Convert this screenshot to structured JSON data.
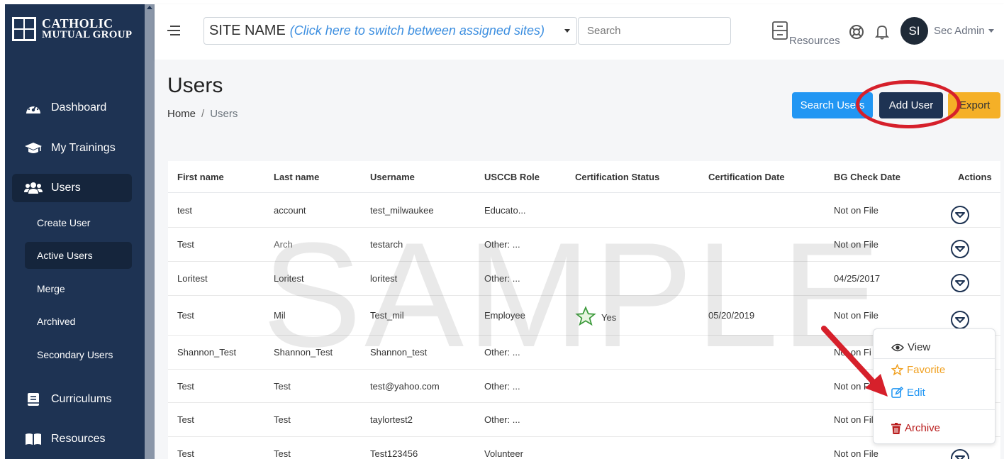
{
  "brand": {
    "line1": "CATHOLIC",
    "line2": "MUTUAL GROUP"
  },
  "sidebar": {
    "items": [
      {
        "label": "Dashboard",
        "icon": "dashboard-icon"
      },
      {
        "label": "My Trainings",
        "icon": "graduation-cap-icon"
      },
      {
        "label": "Users",
        "icon": "users-icon"
      },
      {
        "label": "Curriculums",
        "icon": "book-icon"
      },
      {
        "label": "Resources",
        "icon": "open-book-icon"
      }
    ],
    "users_sub": [
      "Create User",
      "Active Users",
      "Merge",
      "Archived",
      "Secondary Users"
    ]
  },
  "topbar": {
    "site_name": "SITE NAME",
    "site_hint": "(Click here to switch between assigned sites)",
    "search_placeholder": "Search",
    "resources_label": "Resources",
    "avatar_initials": "SI",
    "user_name": "Sec Admin"
  },
  "page": {
    "title": "Users",
    "breadcrumb_home": "Home",
    "breadcrumb_sep": "/",
    "breadcrumb_current": "Users"
  },
  "buttons": {
    "search_users": "Search Users",
    "add_user": "Add User",
    "export": "Export"
  },
  "table": {
    "headers": [
      "First name",
      "Last name",
      "Username",
      "USCCB Role",
      "Certification Status",
      "Certification Date",
      "BG Check Date",
      "Actions"
    ],
    "rows": [
      {
        "first": "test",
        "last": "account",
        "username": "test_milwaukee",
        "role": "Educato...",
        "cert_status": "",
        "cert_date": "",
        "bg": "Not on File"
      },
      {
        "first": "Test",
        "last": "Arch",
        "username": "testarch",
        "role": "Other: ...",
        "cert_status": "",
        "cert_date": "",
        "bg": "Not on File"
      },
      {
        "first": "Loritest",
        "last": "Loritest",
        "username": "loritest",
        "role": "Other: ...",
        "cert_status": "",
        "cert_date": "",
        "bg": "04/25/2017"
      },
      {
        "first": "Test",
        "last": "Mil",
        "username": "Test_mil",
        "role": "Employee",
        "cert_status": "Yes",
        "cert_date": "05/20/2019",
        "bg": "Not on File"
      },
      {
        "first": "Shannon_Test",
        "last": "Shannon_Test",
        "username": "Shannon_test",
        "role": "Other: ...",
        "cert_status": "",
        "cert_date": "",
        "bg": "Not on Fi"
      },
      {
        "first": "Test",
        "last": "Test",
        "username": "test@yahoo.com",
        "role": "Other: ...",
        "cert_status": "",
        "cert_date": "",
        "bg": "Not on Fi"
      },
      {
        "first": "Test",
        "last": "Test",
        "username": "taylortest2",
        "role": "Other: ...",
        "cert_status": "",
        "cert_date": "",
        "bg": "Not on File"
      },
      {
        "first": "Test",
        "last": "Test",
        "username": "Test123456",
        "role": "Volunteer",
        "cert_status": "",
        "cert_date": "",
        "bg": "Not on File"
      }
    ]
  },
  "watermark": "SAMPLE",
  "action_menu": {
    "view": "View",
    "favorite": "Favorite",
    "edit": "Edit",
    "archive": "Archive"
  },
  "colors": {
    "sidebar_bg": "#1e3353",
    "primary_blue": "#2196f3",
    "add_user_bg": "#1e3353",
    "export_bg": "#f5b027",
    "annotation_red": "#d6202b",
    "favorite_color": "#f0a020",
    "edit_color": "#2196f3",
    "archive_color": "#b91c1c",
    "certified_star": "#3c9a3c"
  }
}
